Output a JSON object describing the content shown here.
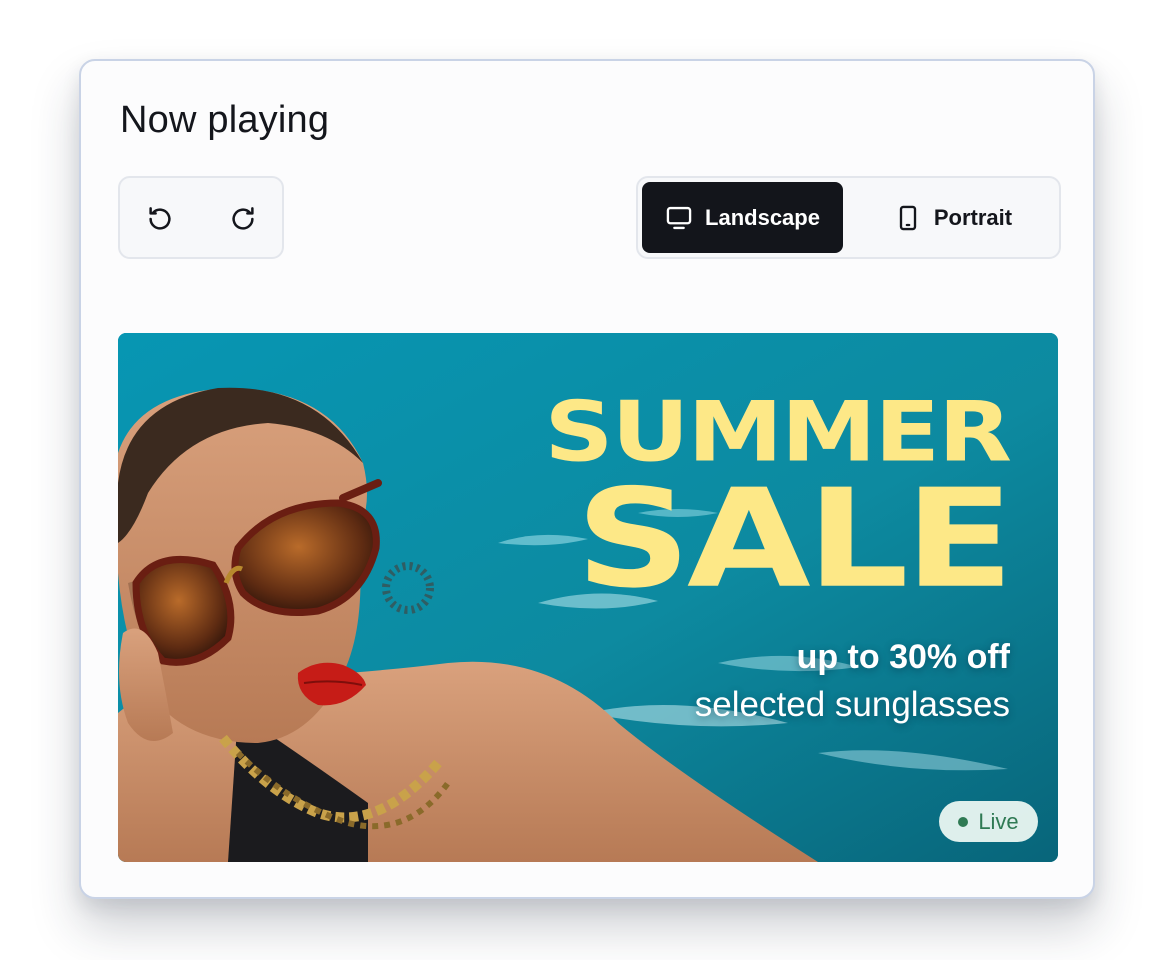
{
  "panel": {
    "title": "Now playing"
  },
  "history": {
    "undo_icon": "undo-icon",
    "redo_icon": "redo-icon"
  },
  "orientation": {
    "selected": "Landscape",
    "options": [
      {
        "label": "Landscape",
        "icon": "monitor-icon",
        "selected": true
      },
      {
        "label": "Portrait",
        "icon": "tablet-icon",
        "selected": false
      }
    ]
  },
  "preview": {
    "headline_line1": "SUMMER",
    "headline_line2": "SALE",
    "offer": "up to 30% off",
    "offer_detail": "selected sunglasses",
    "status": "Live"
  },
  "colors": {
    "selected_button_bg": "#13151b",
    "headline": "#fde887",
    "water": "#0a8ea3",
    "live_badge_text": "#2f7a54"
  }
}
